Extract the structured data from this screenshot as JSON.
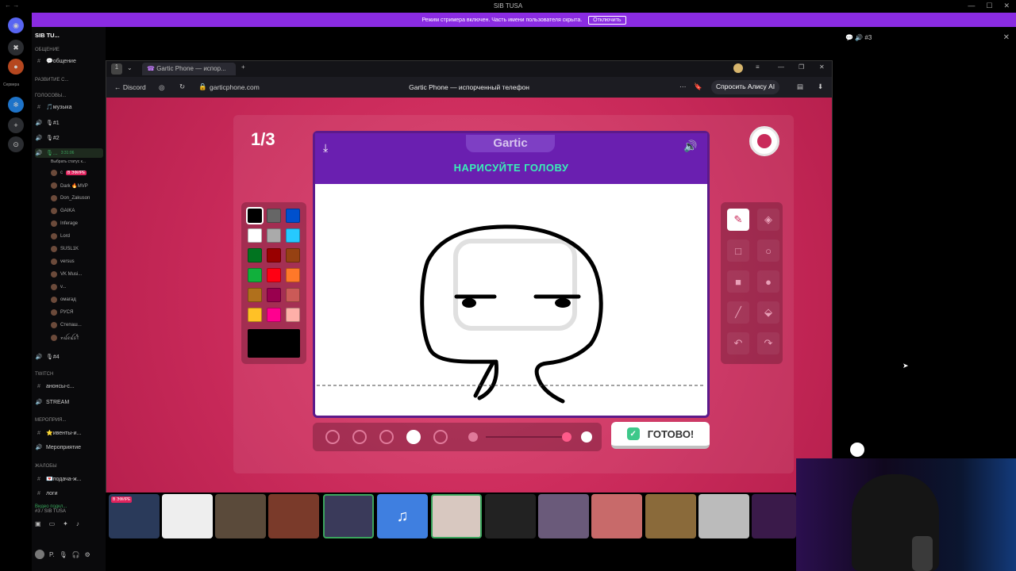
{
  "window": {
    "title": "SIB TUSA"
  },
  "banner": {
    "text": "Режим стримера включен. Часть имени пользователя скрыта.",
    "button": "Отключить"
  },
  "rail": {
    "servers_label": "Сервера"
  },
  "sidebar": {
    "guild": "SIB TU...",
    "rows": [
      {
        "type": "cat",
        "label": "ОБЩЕНИЕ"
      },
      {
        "type": "ch",
        "icon": "#",
        "label": "💬общение"
      },
      {
        "type": "cat",
        "label": "РАЗВИТИЕ С..."
      },
      {
        "type": "cat",
        "label": "ГОЛОСОВЫ..."
      },
      {
        "type": "ch",
        "icon": "#",
        "label": "🎵музыка"
      },
      {
        "type": "ch",
        "icon": "🔊",
        "label": "🎙#1"
      },
      {
        "type": "ch",
        "icon": "🔊",
        "label": "🎙#2"
      },
      {
        "type": "ch-active",
        "icon": "🔊",
        "label": "🎙...",
        "extra": "3:31:06"
      },
      {
        "type": "status",
        "label": "Выбрать статус к..."
      },
      {
        "type": "usr",
        "label": "c",
        "live": "В ЭФИРЕ"
      },
      {
        "type": "usr",
        "label": "Dark 🔥MVP"
      },
      {
        "type": "usr",
        "label": "Don_Zakuson"
      },
      {
        "type": "usr",
        "label": "GAIKA"
      },
      {
        "type": "usr",
        "label": "Inferage"
      },
      {
        "type": "usr",
        "label": "Lord"
      },
      {
        "type": "usr",
        "label": "SUSL1K"
      },
      {
        "type": "usr",
        "label": "versus"
      },
      {
        "type": "usr",
        "label": "VK Musi..."
      },
      {
        "type": "usr",
        "label": "v..."
      },
      {
        "type": "usr",
        "label": "омагад"
      },
      {
        "type": "usr",
        "label": "РУСЯ"
      },
      {
        "type": "usr",
        "label": "Степаш..."
      },
      {
        "type": "usr",
        "label": "ꪀꪊꫀꪊ𝘴ꪻ"
      },
      {
        "type": "ch",
        "icon": "🔊",
        "label": "🎙#4"
      },
      {
        "type": "cat",
        "label": "TWITCH"
      },
      {
        "type": "ch",
        "icon": "#",
        "label": "анонсы-с..."
      },
      {
        "type": "ch",
        "icon": "🔊",
        "label": "STREAM"
      },
      {
        "type": "cat",
        "label": "МЕРОПРИЯ..."
      },
      {
        "type": "ch",
        "icon": "#",
        "label": "⭐ивенты-и..."
      },
      {
        "type": "ch",
        "icon": "🔊",
        "label": "Мероприятие"
      },
      {
        "type": "cat",
        "label": "ЖАЛОБЫ"
      },
      {
        "type": "ch",
        "icon": "#",
        "label": "💌подача-ж..."
      },
      {
        "type": "ch",
        "icon": "#",
        "label": "логи"
      }
    ],
    "voice": {
      "status": "Видео подкл...",
      "channel": "#3 / SIB TUSA"
    },
    "user": "P."
  },
  "browser": {
    "tab_count": "1",
    "tab_title": "Gartic Phone — испор...",
    "back_label": "Discord",
    "url": "garticphone.com",
    "page_title": "Gartic Phone — испорченный телефон",
    "alice": "Спросить Алису AI"
  },
  "game": {
    "round": "1/3",
    "logo": "Gartic",
    "prompt": "НАРИСУЙТЕ ГОЛОВУ",
    "ready": "ГОТОВО!",
    "palette": [
      "#000000",
      "#666666",
      "#0050cd",
      "#ffffff",
      "#aaaaaa",
      "#26c9ff",
      "#017420",
      "#990000",
      "#964112",
      "#11b03c",
      "#ff0013",
      "#ff7829",
      "#b0701c",
      "#99004e",
      "#cb5a57",
      "#ffc126",
      "#ff008f",
      "#feafa8"
    ],
    "selected_color": "#000000",
    "tools": [
      "pencil-icon",
      "eraser-icon",
      "rect-outline-icon",
      "circle-outline-icon",
      "rect-fill-icon",
      "circle-fill-icon",
      "line-icon",
      "bucket-icon",
      "undo-icon",
      "redo-icon"
    ],
    "selected_tool": "pencil-icon"
  },
  "right_panel": {
    "channel": "#3"
  },
  "stream_strip": {
    "badge": "В ЭФИРЕ"
  }
}
